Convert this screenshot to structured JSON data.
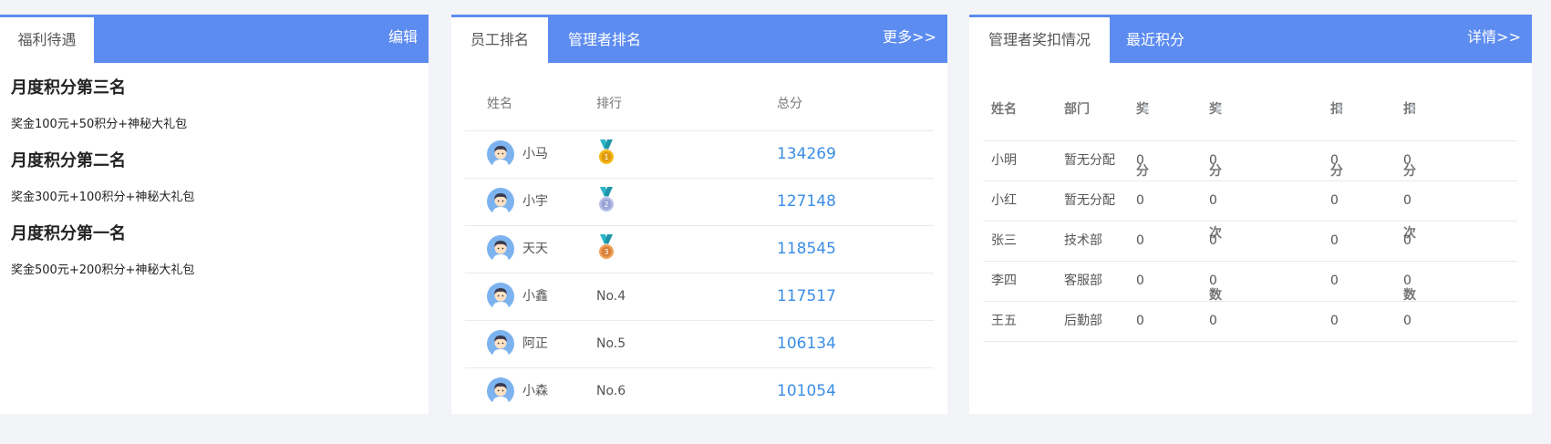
{
  "benefits_panel": {
    "tab": "福利待遇",
    "edit": "编辑",
    "items": [
      {
        "title": "月度积分第三名",
        "desc": "奖金100元+50积分+神秘大礼包"
      },
      {
        "title": "月度积分第二名",
        "desc": "奖金300元+100积分+神秘大礼包"
      },
      {
        "title": "月度积分第一名",
        "desc": "奖金500元+200积分+神秘大礼包"
      }
    ]
  },
  "ranking_panel": {
    "tabs": [
      "员工排名",
      "管理者排名"
    ],
    "more": "更多>>",
    "columns": {
      "name": "姓名",
      "rank": "排行",
      "total": "总分"
    },
    "rows": [
      {
        "name": "小马",
        "rank": "",
        "medal": "gold-medal-icon",
        "total": "134269"
      },
      {
        "name": "小宇",
        "rank": "",
        "medal": "silver-medal-icon",
        "total": "127148"
      },
      {
        "name": "天天",
        "rank": "",
        "medal": "bronze-medal-icon",
        "total": "118545"
      },
      {
        "name": "小鑫",
        "rank": "No.4",
        "medal": null,
        "total": "117517"
      },
      {
        "name": "阿正",
        "rank": "No.5",
        "medal": null,
        "total": "106134"
      },
      {
        "name": "小森",
        "rank": "No.6",
        "medal": null,
        "total": "101054"
      }
    ]
  },
  "score_panel": {
    "tabs": [
      "管理者奖扣情况",
      "最近积分"
    ],
    "detail": "详情>>",
    "columns": [
      "姓名",
      "部门",
      "奖分",
      "奖分次数",
      "扣分",
      "扣分次数"
    ],
    "rows": [
      [
        "小明",
        "暂无分配",
        "0",
        "0",
        "0",
        "0"
      ],
      [
        "小红",
        "暂无分配",
        "0",
        "0",
        "0",
        "0"
      ],
      [
        "张三",
        "技术部",
        "0",
        "0",
        "0",
        "0"
      ],
      [
        "李四",
        "客服部",
        "0",
        "0",
        "0",
        "0"
      ],
      [
        "王五",
        "后勤部",
        "0",
        "0",
        "0",
        "0"
      ]
    ]
  },
  "colors": {
    "header": "#5d8cf0",
    "score": "#3a8ee6",
    "background": "#f2f4f7"
  }
}
